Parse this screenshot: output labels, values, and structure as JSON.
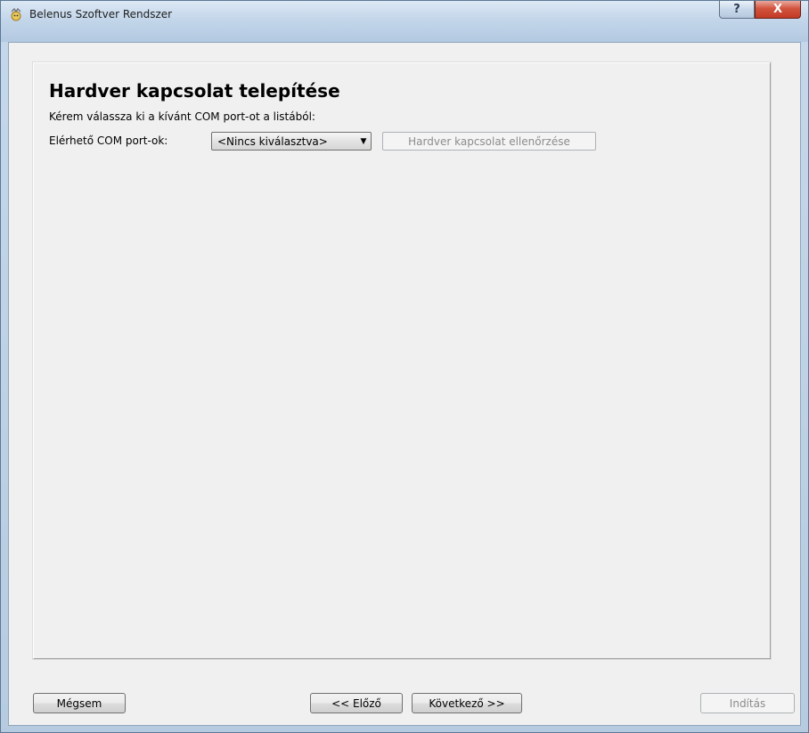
{
  "window": {
    "title": "Belenus Szoftver Rendszer",
    "help_glyph": "?",
    "close_glyph": "X"
  },
  "page": {
    "title": "Hardver kapcsolat telepítése",
    "instruction": "Kérem válassza ki a kívánt COM port-ot a listából:",
    "com_label": "Elérhető COM port-ok:",
    "com_select_value": "<Nincs kiválasztva>",
    "check_button": "Hardver kapcsolat ellenőrzése"
  },
  "footer": {
    "cancel": "Mégsem",
    "prev": "<< Előző",
    "next": "Következő >>",
    "start": "Indítás"
  },
  "icons": {
    "app": "app-icon",
    "help": "help-icon",
    "close": "close-icon",
    "dropdown": "chevron-down-icon"
  },
  "colors": {
    "title_bar": "#c3d6ea",
    "close_button": "#c23a24",
    "client_bg": "#f0f0f0",
    "disabled_text": "#8c8c8c"
  }
}
